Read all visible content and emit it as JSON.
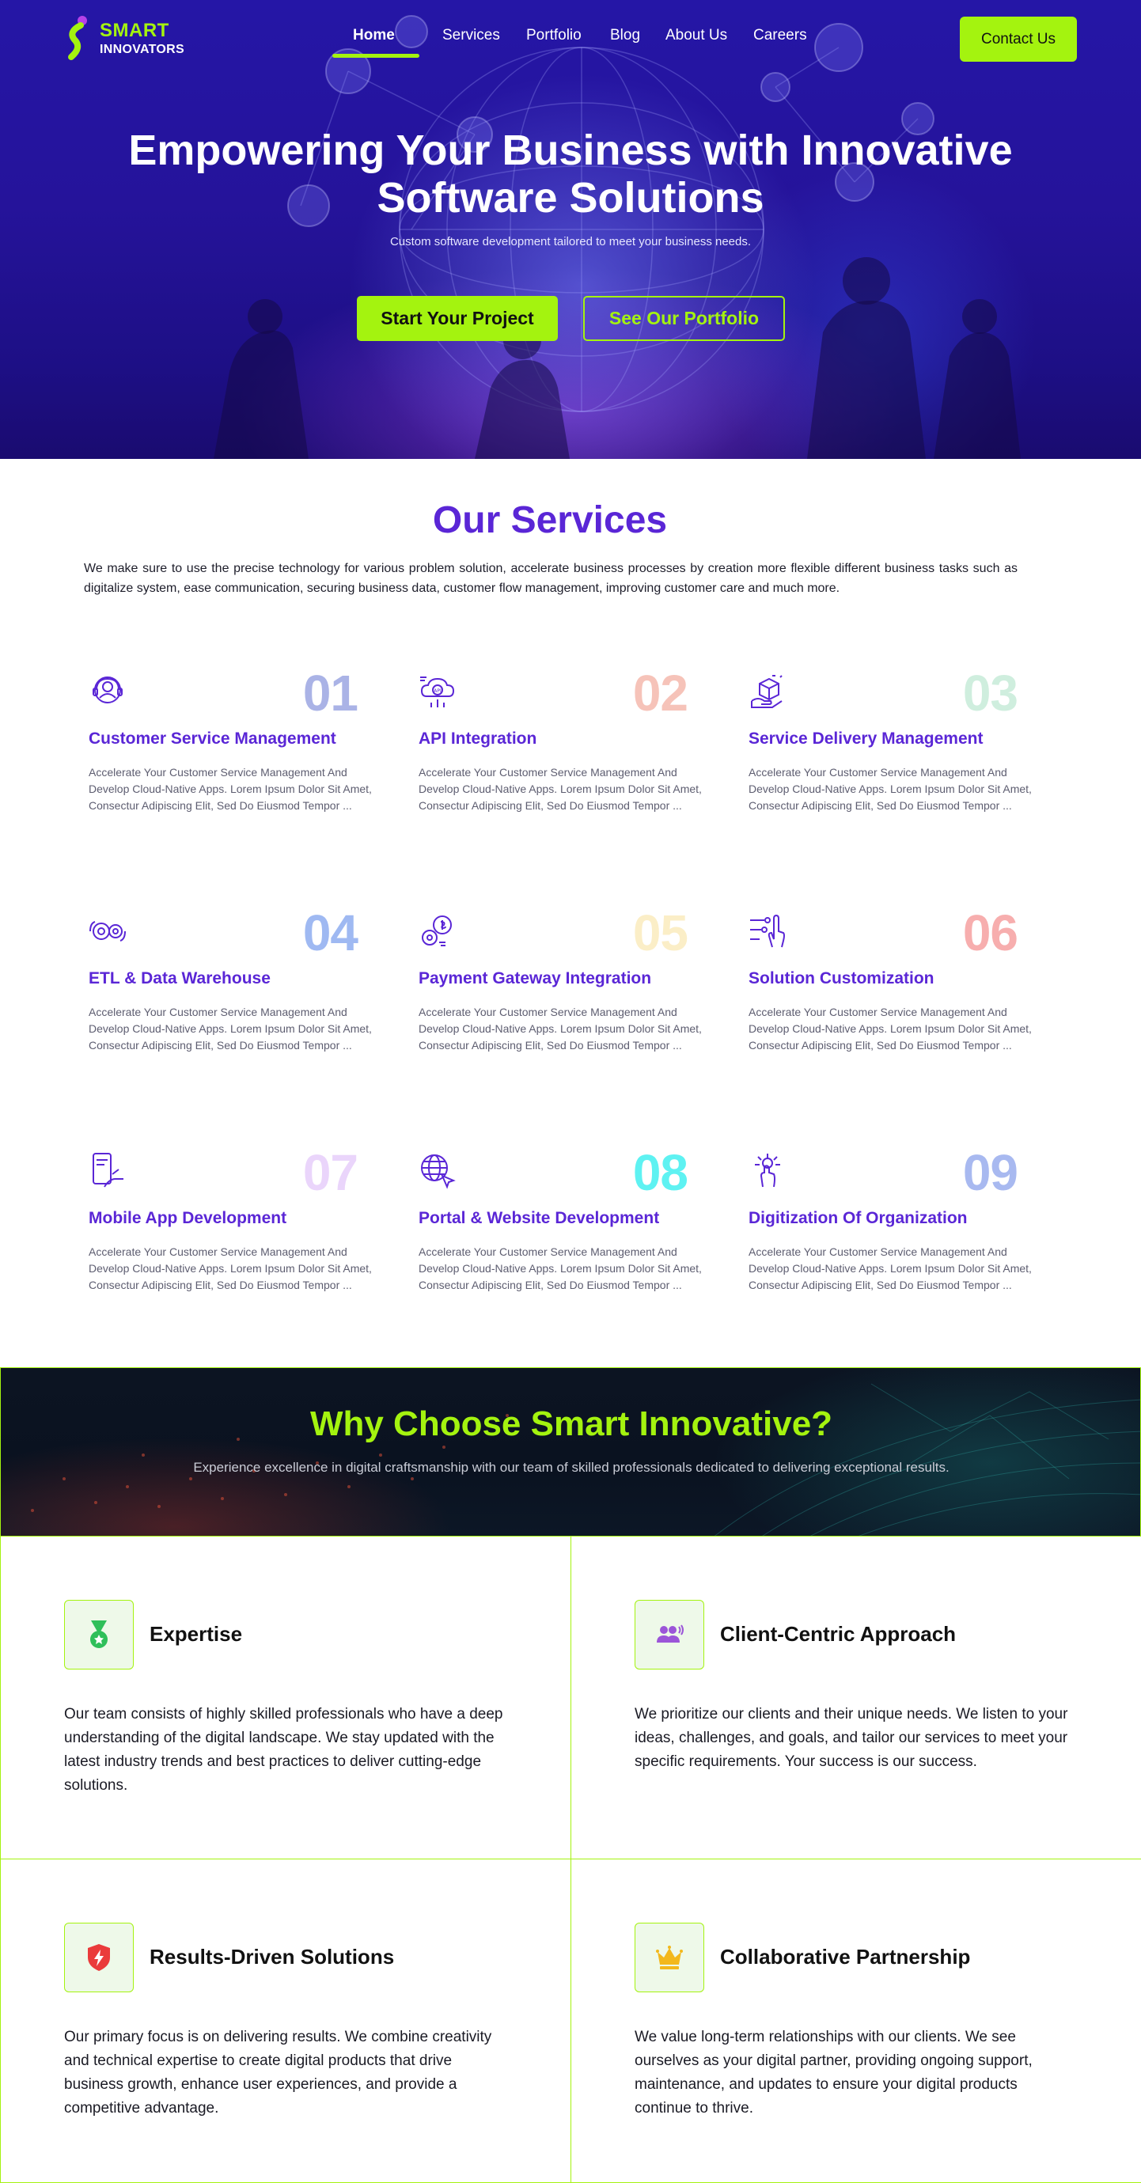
{
  "brand": {
    "line1": "SMART",
    "line2": "INNOVATORS",
    "colors": {
      "accent": "#a4f30f",
      "purple": "#5a26d6",
      "hero_bg": "#25139a"
    }
  },
  "nav": {
    "items": [
      {
        "label": "Home",
        "active": true
      },
      {
        "label": "Services",
        "active": false
      },
      {
        "label": "Portfolio",
        "active": false
      },
      {
        "label": "Blog",
        "active": false
      },
      {
        "label": "About Us",
        "active": false
      },
      {
        "label": "Careers",
        "active": false
      }
    ],
    "contact_label": "Contact Us"
  },
  "hero": {
    "title_line1": "Empowering Your Business with Innovative",
    "title_line2": "Software Solutions",
    "subtitle": "Custom software development tailored to meet your business needs.",
    "primary_cta": "Start Your Project",
    "secondary_cta": "See Our Portfolio"
  },
  "services": {
    "title": "Our Services",
    "intro": "We make sure to use the precise technology for various problem solution, accelerate business processes by creation more flexible different business tasks such as digitalize system, ease communication, securing business data, customer flow management, improving customer care and much more.",
    "items": [
      {
        "number": "01",
        "title": "Customer Service Management",
        "icon": "headset-user-icon",
        "num_color": "#aab3e6",
        "desc": "Accelerate Your Customer Service Management And Develop Cloud-Native Apps. Lorem Ipsum Dolor Sit Amet, Consectur Adipiscing Elit, Sed Do Eiusmod Tempor ..."
      },
      {
        "number": "02",
        "title": "API Integration",
        "icon": "api-cloud-icon",
        "num_color": "#f6c3b9",
        "desc": "Accelerate Your Customer Service Management And Develop Cloud-Native Apps. Lorem Ipsum Dolor Sit Amet, Consectur Adipiscing Elit, Sed Do Eiusmod Tempor ..."
      },
      {
        "number": "03",
        "title": "Service Delivery Management",
        "icon": "delivery-box-icon",
        "num_color": "#cfeede",
        "desc": "Accelerate Your Customer Service Management And Develop Cloud-Native Apps. Lorem Ipsum Dolor Sit Amet, Consectur Adipiscing Elit, Sed Do Eiusmod Tempor ..."
      },
      {
        "number": "04",
        "title": "ETL & Data Warehouse",
        "icon": "data-gears-icon",
        "num_color": "#9fb9f2",
        "desc": "Accelerate Your Customer Service Management And Develop Cloud-Native Apps. Lorem Ipsum Dolor Sit Amet, Consectur Adipiscing Elit, Sed Do Eiusmod Tempor ..."
      },
      {
        "number": "05",
        "title": "Payment Gateway Integration",
        "icon": "payment-gear-icon",
        "num_color": "#fbeec7",
        "desc": "Accelerate Your Customer Service Management And Develop Cloud-Native Apps. Lorem Ipsum Dolor Sit Amet, Consectur Adipiscing Elit, Sed Do Eiusmod Tempor ..."
      },
      {
        "number": "06",
        "title": "Solution Customization",
        "icon": "custom-touch-icon",
        "num_color": "#f7aeae",
        "desc": "Accelerate Your Customer Service Management And Develop Cloud-Native Apps. Lorem Ipsum Dolor Sit Amet, Consectur Adipiscing Elit, Sed Do Eiusmod Tempor ..."
      },
      {
        "number": "07",
        "title": "Mobile App Development",
        "icon": "mobile-app-icon",
        "num_color": "#ead5fb",
        "desc": "Accelerate Your Customer Service Management And Develop Cloud-Native Apps. Lorem Ipsum Dolor Sit Amet, Consectur Adipiscing Elit, Sed Do Eiusmod Tempor ..."
      },
      {
        "number": "08",
        "title": "Portal & Website Development",
        "icon": "globe-cursor-icon",
        "num_color": "#5ef2f2",
        "desc": "Accelerate Your Customer Service Management And Develop Cloud-Native Apps. Lorem Ipsum Dolor Sit Amet, Consectur Adipiscing Elit, Sed Do Eiusmod Tempor ..."
      },
      {
        "number": "09",
        "title": "Digitization Of Organization",
        "icon": "digital-hand-icon",
        "num_color": "#a8b9f0",
        "desc": "Accelerate Your Customer Service Management And Develop Cloud-Native Apps. Lorem Ipsum Dolor Sit Amet, Consectur Adipiscing Elit, Sed Do Eiusmod Tempor ..."
      }
    ]
  },
  "why": {
    "title": "Why Choose Smart Innovative?",
    "subtitle": "Experience excellence in digital craftsmanship with our team of skilled professionals dedicated to delivering exceptional results.",
    "items": [
      {
        "title": "Expertise",
        "icon": "medal-icon",
        "text": "Our team consists of highly skilled professionals who have a deep understanding of the digital landscape. We stay updated with the latest industry trends and best practices to deliver cutting-edge solutions."
      },
      {
        "title": "Client-Centric Approach",
        "icon": "people-icon",
        "text": "We prioritize our clients and their unique needs. We listen to your ideas, challenges, and goals, and tailor our services to meet your specific requirements. Your success is our success."
      },
      {
        "title": "Results-Driven Solutions",
        "icon": "shield-bolt-icon",
        "text": "Our primary focus is on delivering results. We combine creativity and technical expertise to create digital products that drive business growth, enhance user experiences, and provide a competitive advantage."
      },
      {
        "title": "Collaborative Partnership",
        "icon": "crown-icon",
        "text": "We value long-term relationships with our clients. We see ourselves as your digital partner, providing ongoing support, maintenance, and updates to ensure your digital products continue to thrive."
      }
    ]
  }
}
